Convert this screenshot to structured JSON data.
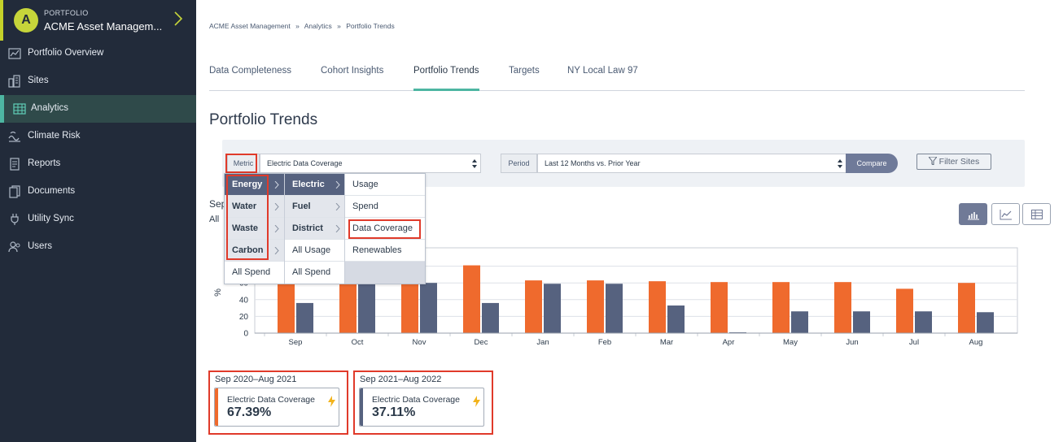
{
  "sidebar": {
    "avatar_letter": "A",
    "org_kicker": "PORTFOLIO",
    "org_name": "ACME Asset Managem...",
    "items": [
      {
        "label": "Portfolio Overview",
        "icon": "chart-line-icon"
      },
      {
        "label": "Sites",
        "icon": "buildings-icon"
      },
      {
        "label": "Analytics",
        "icon": "table-chart-icon",
        "active": true
      },
      {
        "label": "Climate Risk",
        "icon": "wave-icon"
      },
      {
        "label": "Reports",
        "icon": "report-icon"
      },
      {
        "label": "Documents",
        "icon": "documents-icon"
      },
      {
        "label": "Utility Sync",
        "icon": "plug-icon"
      },
      {
        "label": "Users",
        "icon": "users-icon"
      }
    ]
  },
  "breadcrumb": [
    "ACME Asset Management",
    "»",
    "Analytics",
    "»",
    "Portfolio Trends"
  ],
  "tabs": [
    "Data Completeness",
    "Cohort Insights",
    "Portfolio Trends",
    "Targets",
    "NY Local Law 97"
  ],
  "active_tab": "Portfolio Trends",
  "page_title": "Portfolio Trends",
  "filters": {
    "metric_label": "Metric",
    "metric_value": "Electric Data Coverage",
    "period_label": "Period",
    "period_value": "Last 12 Months vs. Prior Year",
    "compare_label": "Compare",
    "filter_sites_label": "Filter Sites"
  },
  "hidden_text": {
    "line1": "Sep",
    "line2": "All"
  },
  "metric_menu": {
    "col1": [
      "Energy",
      "Water",
      "Waste",
      "Carbon",
      "All Spend"
    ],
    "col2": [
      "Electric",
      "Fuel",
      "District",
      "All Usage",
      "All Spend"
    ],
    "col3": [
      "Usage",
      "Spend",
      "Data Coverage",
      "Renewables"
    ]
  },
  "colors": {
    "orange": "#ef6a2d",
    "navy": "#56627f",
    "sidebar_bg": "#222b3a",
    "accent_teal": "#4db6a2",
    "highlight_red": "#e03a2a"
  },
  "chart_data": {
    "type": "bar",
    "ylabel": "%",
    "ylim": [
      0,
      100
    ],
    "yticks": [
      0,
      20,
      40,
      60
    ],
    "categories": [
      "Sep",
      "Oct",
      "Nov",
      "Dec",
      "Jan",
      "Feb",
      "Mar",
      "Apr",
      "May",
      "Jun",
      "Jul",
      "Aug"
    ],
    "series": [
      {
        "name": "Sep 2020–Aug 2021",
        "color": "#ef6a2d",
        "values": [
          68,
          68,
          68,
          81,
          63,
          63,
          62,
          61,
          61,
          61,
          53,
          60
        ]
      },
      {
        "name": "Sep 2021–Aug 2022",
        "color": "#56627f",
        "values": [
          36,
          60,
          60,
          36,
          59,
          59,
          33,
          1,
          26,
          26,
          26,
          25
        ]
      }
    ]
  },
  "summary": [
    {
      "period": "Sep 2020–Aug 2021",
      "label": "Electric Data Coverage",
      "value": "67.39%",
      "color": "#ef6a2d"
    },
    {
      "period": "Sep 2021–Aug 2022",
      "label": "Electric Data Coverage",
      "value": "37.11%",
      "color": "#56627f"
    }
  ]
}
